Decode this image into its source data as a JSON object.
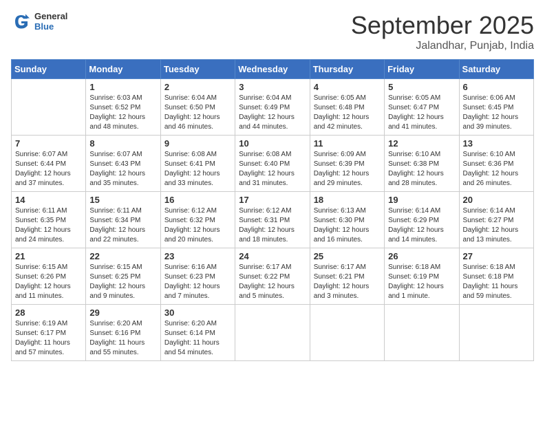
{
  "header": {
    "logo_general": "General",
    "logo_blue": "Blue",
    "title": "September 2025",
    "subtitle": "Jalandhar, Punjab, India"
  },
  "calendar": {
    "days_of_week": [
      "Sunday",
      "Monday",
      "Tuesday",
      "Wednesday",
      "Thursday",
      "Friday",
      "Saturday"
    ],
    "weeks": [
      [
        {
          "day": "",
          "sunrise": "",
          "sunset": "",
          "daylight": ""
        },
        {
          "day": "1",
          "sunrise": "Sunrise: 6:03 AM",
          "sunset": "Sunset: 6:52 PM",
          "daylight": "Daylight: 12 hours and 48 minutes."
        },
        {
          "day": "2",
          "sunrise": "Sunrise: 6:04 AM",
          "sunset": "Sunset: 6:50 PM",
          "daylight": "Daylight: 12 hours and 46 minutes."
        },
        {
          "day": "3",
          "sunrise": "Sunrise: 6:04 AM",
          "sunset": "Sunset: 6:49 PM",
          "daylight": "Daylight: 12 hours and 44 minutes."
        },
        {
          "day": "4",
          "sunrise": "Sunrise: 6:05 AM",
          "sunset": "Sunset: 6:48 PM",
          "daylight": "Daylight: 12 hours and 42 minutes."
        },
        {
          "day": "5",
          "sunrise": "Sunrise: 6:05 AM",
          "sunset": "Sunset: 6:47 PM",
          "daylight": "Daylight: 12 hours and 41 minutes."
        },
        {
          "day": "6",
          "sunrise": "Sunrise: 6:06 AM",
          "sunset": "Sunset: 6:45 PM",
          "daylight": "Daylight: 12 hours and 39 minutes."
        }
      ],
      [
        {
          "day": "7",
          "sunrise": "Sunrise: 6:07 AM",
          "sunset": "Sunset: 6:44 PM",
          "daylight": "Daylight: 12 hours and 37 minutes."
        },
        {
          "day": "8",
          "sunrise": "Sunrise: 6:07 AM",
          "sunset": "Sunset: 6:43 PM",
          "daylight": "Daylight: 12 hours and 35 minutes."
        },
        {
          "day": "9",
          "sunrise": "Sunrise: 6:08 AM",
          "sunset": "Sunset: 6:41 PM",
          "daylight": "Daylight: 12 hours and 33 minutes."
        },
        {
          "day": "10",
          "sunrise": "Sunrise: 6:08 AM",
          "sunset": "Sunset: 6:40 PM",
          "daylight": "Daylight: 12 hours and 31 minutes."
        },
        {
          "day": "11",
          "sunrise": "Sunrise: 6:09 AM",
          "sunset": "Sunset: 6:39 PM",
          "daylight": "Daylight: 12 hours and 29 minutes."
        },
        {
          "day": "12",
          "sunrise": "Sunrise: 6:10 AM",
          "sunset": "Sunset: 6:38 PM",
          "daylight": "Daylight: 12 hours and 28 minutes."
        },
        {
          "day": "13",
          "sunrise": "Sunrise: 6:10 AM",
          "sunset": "Sunset: 6:36 PM",
          "daylight": "Daylight: 12 hours and 26 minutes."
        }
      ],
      [
        {
          "day": "14",
          "sunrise": "Sunrise: 6:11 AM",
          "sunset": "Sunset: 6:35 PM",
          "daylight": "Daylight: 12 hours and 24 minutes."
        },
        {
          "day": "15",
          "sunrise": "Sunrise: 6:11 AM",
          "sunset": "Sunset: 6:34 PM",
          "daylight": "Daylight: 12 hours and 22 minutes."
        },
        {
          "day": "16",
          "sunrise": "Sunrise: 6:12 AM",
          "sunset": "Sunset: 6:32 PM",
          "daylight": "Daylight: 12 hours and 20 minutes."
        },
        {
          "day": "17",
          "sunrise": "Sunrise: 6:12 AM",
          "sunset": "Sunset: 6:31 PM",
          "daylight": "Daylight: 12 hours and 18 minutes."
        },
        {
          "day": "18",
          "sunrise": "Sunrise: 6:13 AM",
          "sunset": "Sunset: 6:30 PM",
          "daylight": "Daylight: 12 hours and 16 minutes."
        },
        {
          "day": "19",
          "sunrise": "Sunrise: 6:14 AM",
          "sunset": "Sunset: 6:29 PM",
          "daylight": "Daylight: 12 hours and 14 minutes."
        },
        {
          "day": "20",
          "sunrise": "Sunrise: 6:14 AM",
          "sunset": "Sunset: 6:27 PM",
          "daylight": "Daylight: 12 hours and 13 minutes."
        }
      ],
      [
        {
          "day": "21",
          "sunrise": "Sunrise: 6:15 AM",
          "sunset": "Sunset: 6:26 PM",
          "daylight": "Daylight: 12 hours and 11 minutes."
        },
        {
          "day": "22",
          "sunrise": "Sunrise: 6:15 AM",
          "sunset": "Sunset: 6:25 PM",
          "daylight": "Daylight: 12 hours and 9 minutes."
        },
        {
          "day": "23",
          "sunrise": "Sunrise: 6:16 AM",
          "sunset": "Sunset: 6:23 PM",
          "daylight": "Daylight: 12 hours and 7 minutes."
        },
        {
          "day": "24",
          "sunrise": "Sunrise: 6:17 AM",
          "sunset": "Sunset: 6:22 PM",
          "daylight": "Daylight: 12 hours and 5 minutes."
        },
        {
          "day": "25",
          "sunrise": "Sunrise: 6:17 AM",
          "sunset": "Sunset: 6:21 PM",
          "daylight": "Daylight: 12 hours and 3 minutes."
        },
        {
          "day": "26",
          "sunrise": "Sunrise: 6:18 AM",
          "sunset": "Sunset: 6:19 PM",
          "daylight": "Daylight: 12 hours and 1 minute."
        },
        {
          "day": "27",
          "sunrise": "Sunrise: 6:18 AM",
          "sunset": "Sunset: 6:18 PM",
          "daylight": "Daylight: 11 hours and 59 minutes."
        }
      ],
      [
        {
          "day": "28",
          "sunrise": "Sunrise: 6:19 AM",
          "sunset": "Sunset: 6:17 PM",
          "daylight": "Daylight: 11 hours and 57 minutes."
        },
        {
          "day": "29",
          "sunrise": "Sunrise: 6:20 AM",
          "sunset": "Sunset: 6:16 PM",
          "daylight": "Daylight: 11 hours and 55 minutes."
        },
        {
          "day": "30",
          "sunrise": "Sunrise: 6:20 AM",
          "sunset": "Sunset: 6:14 PM",
          "daylight": "Daylight: 11 hours and 54 minutes."
        },
        {
          "day": "",
          "sunrise": "",
          "sunset": "",
          "daylight": ""
        },
        {
          "day": "",
          "sunrise": "",
          "sunset": "",
          "daylight": ""
        },
        {
          "day": "",
          "sunrise": "",
          "sunset": "",
          "daylight": ""
        },
        {
          "day": "",
          "sunrise": "",
          "sunset": "",
          "daylight": ""
        }
      ]
    ]
  }
}
